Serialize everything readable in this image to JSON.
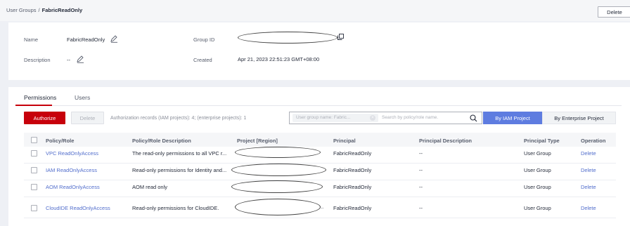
{
  "breadcrumb": {
    "parent": "User Groups",
    "separator": "/",
    "current": "FabricReadOnly"
  },
  "header": {
    "delete_label": "Delete"
  },
  "info": {
    "name_label": "Name",
    "name_value": "FabricReadOnly",
    "description_label": "Description",
    "description_value": "--",
    "group_id_label": "Group ID",
    "created_label": "Created",
    "created_value": "Apr 21, 2023 22:51:23 GMT+08:00"
  },
  "tabs": [
    "Permissions",
    "Users"
  ],
  "toolbar": {
    "authorize_label": "Authorize",
    "delete_label": "Delete",
    "records_text": "Authorization records (IAM projects): 4; (enterprise projects): 1",
    "search_chip": "User group name: Fabric...",
    "search_placeholder": "Search by policy/role name.",
    "by_iam_label": "By IAM Project",
    "by_enterprise_label": "By Enterprise Project"
  },
  "table": {
    "columns": [
      "Policy/Role",
      "Policy/Role Description",
      "Project [Region]",
      "Principal",
      "Principal Description",
      "Principal Type",
      "Operation"
    ],
    "rows": [
      {
        "policy": "VPC ReadOnlyAccess",
        "description": "The read-only permissions to all VPC r...",
        "project": "",
        "principal": "FabricReadOnly",
        "principal_description": "--",
        "principal_type": "User Group",
        "operation": "Delete"
      },
      {
        "policy": "IAM ReadOnlyAccess",
        "description": "Read-only permissions for Identity and...",
        "project": "",
        "principal": "FabricReadOnly",
        "principal_description": "--",
        "principal_type": "User Group",
        "operation": "Delete"
      },
      {
        "policy": "AOM ReadOnlyAccess",
        "description": "AOM read only",
        "project": "",
        "principal": "FabricReadOnly",
        "principal_description": "--",
        "principal_type": "User Group",
        "operation": "Delete"
      },
      {
        "policy": "CloudIDE ReadOnlyAccess",
        "description": "Read-only permissions for CloudIDE.",
        "project": "..",
        "principal": "FabricReadOnly",
        "principal_description": "--",
        "principal_type": "User Group",
        "operation": "Delete"
      }
    ]
  },
  "icons": {
    "edit": "pencil-icon",
    "copy": "copy-icon",
    "search": "search-icon",
    "clear": "clear-icon"
  },
  "colors": {
    "primary_red": "#c7000b",
    "accent_blue": "#5e7ce0",
    "link_blue": "#526ecc"
  }
}
